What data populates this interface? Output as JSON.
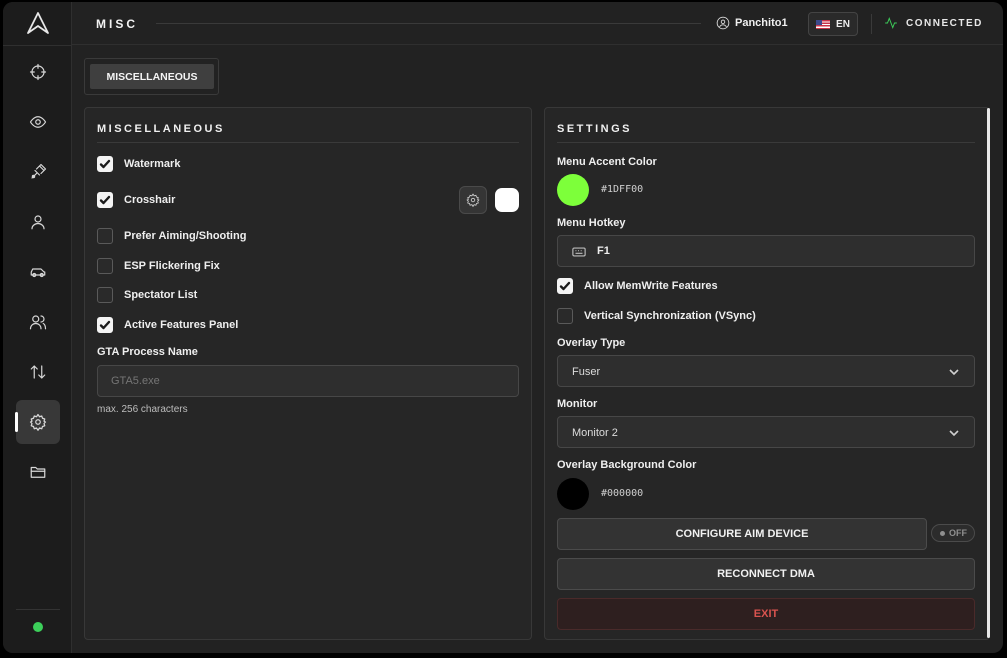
{
  "header": {
    "title": "MISC",
    "username": "Panchito1",
    "language": "EN",
    "connection_status": "CONNECTED"
  },
  "colors": {
    "accent": "#1DFF00",
    "status_green": "#3ccf5a",
    "exit_red": "#d9534f"
  },
  "sidebar": {
    "items": [
      {
        "icon": "crosshair-icon",
        "active": false
      },
      {
        "icon": "eye-icon",
        "active": false
      },
      {
        "icon": "weapon-icon",
        "active": false
      },
      {
        "icon": "user-icon",
        "active": false
      },
      {
        "icon": "car-icon",
        "active": false
      },
      {
        "icon": "users-icon",
        "active": false
      },
      {
        "icon": "arrows-updown-icon",
        "active": false
      },
      {
        "icon": "gear-icon",
        "active": true
      },
      {
        "icon": "folder-icon",
        "active": false
      }
    ]
  },
  "tabs": [
    {
      "label": "MISCELLANEOUS",
      "active": true
    }
  ],
  "misc_panel": {
    "title": "MISCELLANEOUS",
    "options": [
      {
        "label": "Watermark",
        "checked": true
      },
      {
        "label": "Crosshair",
        "checked": true
      },
      {
        "label": "Prefer Aiming/Shooting",
        "checked": false
      },
      {
        "label": "ESP Flickering Fix",
        "checked": false
      },
      {
        "label": "Spectator List",
        "checked": false
      },
      {
        "label": "Active Features Panel",
        "checked": true
      }
    ],
    "process_name_label": "GTA Process Name",
    "process_name_placeholder": "GTA5.exe",
    "process_name_hint": "max. 256 characters"
  },
  "settings_panel": {
    "title": "SETTINGS",
    "accent_label": "Menu Accent Color",
    "accent_hex": "#1DFF00",
    "hotkey_label": "Menu Hotkey",
    "hotkey_value": "F1",
    "allow_memwrite_label": "Allow MemWrite Features",
    "allow_memwrite_checked": true,
    "vsync_label": "Vertical Synchronization (VSync)",
    "vsync_checked": false,
    "overlay_type_label": "Overlay Type",
    "overlay_type_value": "Fuser",
    "monitor_label": "Monitor",
    "monitor_value": "Monitor 2",
    "overlay_bg_label": "Overlay Background Color",
    "overlay_bg_hex": "#000000",
    "configure_aim_label": "CONFIGURE AIM DEVICE",
    "aim_toggle_label": "OFF",
    "reconnect_label": "RECONNECT DMA",
    "exit_label": "EXIT"
  }
}
